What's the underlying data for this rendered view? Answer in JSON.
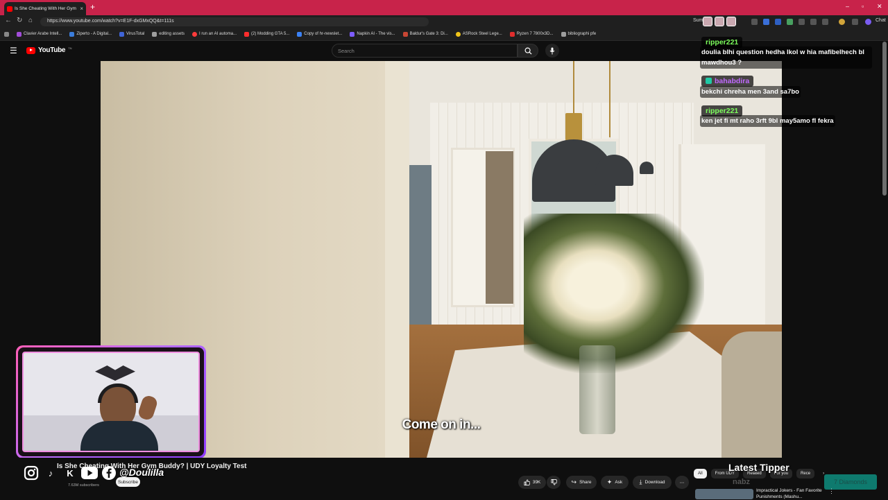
{
  "browser": {
    "tab_title": "Is She Cheating With Her Gym Bu...",
    "new_tab": "+",
    "url": "https://www.youtube.com/watch?v=E1F-dxGMxQQ&t=111s",
    "sum_label": "Sum",
    "chat_label": "Chat",
    "bookmarks": [
      {
        "label": "Clavier Arabe Intell...",
        "color": "#a24dd9"
      },
      {
        "label": "Ziperto - A Digital...",
        "color": "#3b7ddb"
      },
      {
        "label": "VirusTotal",
        "color": "#3f64d6"
      },
      {
        "label": "editing assets",
        "color": "#9e9e9e"
      },
      {
        "label": "I run an AI automa...",
        "color": "#ff3b3b"
      },
      {
        "label": "(2) Modding GTA 5...",
        "color": "#ff2d2d"
      },
      {
        "label": "Copy of hr-newslet...",
        "color": "#3b82f6"
      },
      {
        "label": "Napkin AI - The vis...",
        "color": "#7d5cff"
      },
      {
        "label": "Baldur's Gate 3: Di...",
        "color": "#c74634"
      },
      {
        "label": "ASRock Steel Lege...",
        "color": "#f0c419"
      },
      {
        "label": "Ryzen 7 7800x3D...",
        "color": "#e02d2d"
      },
      {
        "label": "bibliographi pfe",
        "color": "#9e9e9e"
      }
    ]
  },
  "youtube": {
    "logo_text": "YouTube",
    "logo_tm": "TN",
    "search_placeholder": "Search"
  },
  "video": {
    "caption": "Come on in..."
  },
  "chat": {
    "messages": [
      {
        "user": "ripper221",
        "user_color": "#7cff5c",
        "text": "doulia blhi question hedha lkol w hia mafibelhech bl mawdhou3 ?"
      },
      {
        "user": "bahabdira",
        "user_color": "#c069ff",
        "text": "bekchi chreha men 3and sa7bo"
      },
      {
        "user": "ripper221",
        "user_color": "#7cff5c",
        "text": "ken jet fi mt raho 3rft 9bl may5amo fl fekra"
      }
    ]
  },
  "channel": {
    "video_title": "Is She Cheating With Her Gym Buddy? | UDY Loyalty Test",
    "handle": "@Doulilla",
    "subscribers": "7.63M subscribers",
    "subscribe_label": "Subscribe",
    "likes": "39K",
    "share_label": "Share",
    "ask_label": "Ask",
    "download_label": "Download",
    "more_label": "⋯"
  },
  "related": {
    "tabs": [
      "All",
      "From UDY",
      "Related",
      "For you",
      "Rece"
    ],
    "active_tab": "All",
    "first_title": "Impractical Jokers - Fan Favorite Punishments (Mashu..."
  },
  "overlay": {
    "latest_tipper_label": "Latest Tipper",
    "tipper_name": "nabz",
    "tipper_amount": "7 Diamonds"
  }
}
